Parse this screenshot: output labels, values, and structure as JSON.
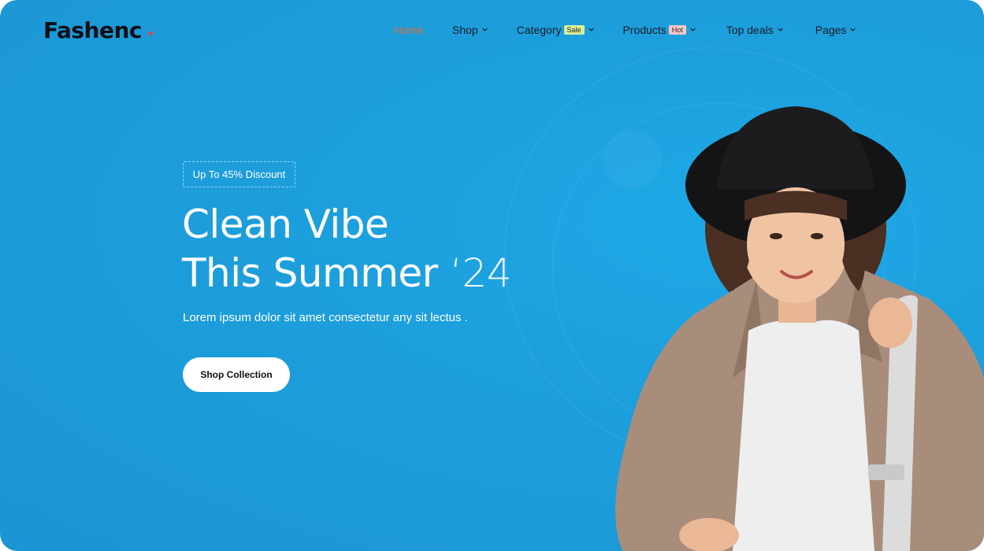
{
  "brand": {
    "logo_text": "Fashenc"
  },
  "nav": {
    "items": [
      {
        "label": "Home",
        "active": true,
        "has_dropdown": false
      },
      {
        "label": "Shop",
        "has_dropdown": true
      },
      {
        "label": "Category",
        "badge": "Sale",
        "has_dropdown": true
      },
      {
        "label": "Products",
        "badge": "Hot",
        "has_dropdown": true
      },
      {
        "label": "Top deals",
        "has_dropdown": true
      },
      {
        "label": "Pages",
        "has_dropdown": true
      }
    ]
  },
  "hero": {
    "discount_label": "Up To 45% Discount",
    "headline_line1": "Clean Vibe",
    "headline_line2": "This Summer",
    "headline_year": "‘24",
    "subtext": "Lorem ipsum dolor sit amet consectetur any sit lectus .",
    "cta_label": "Shop Collection"
  },
  "colors": {
    "background": "#1d9fdc",
    "nav_active": "#e0703a",
    "badge_sale": "#d7ef9a",
    "badge_hot": "#f9c6c6",
    "logo_accent": "#e8364a",
    "cta_background": "#ffffff"
  }
}
